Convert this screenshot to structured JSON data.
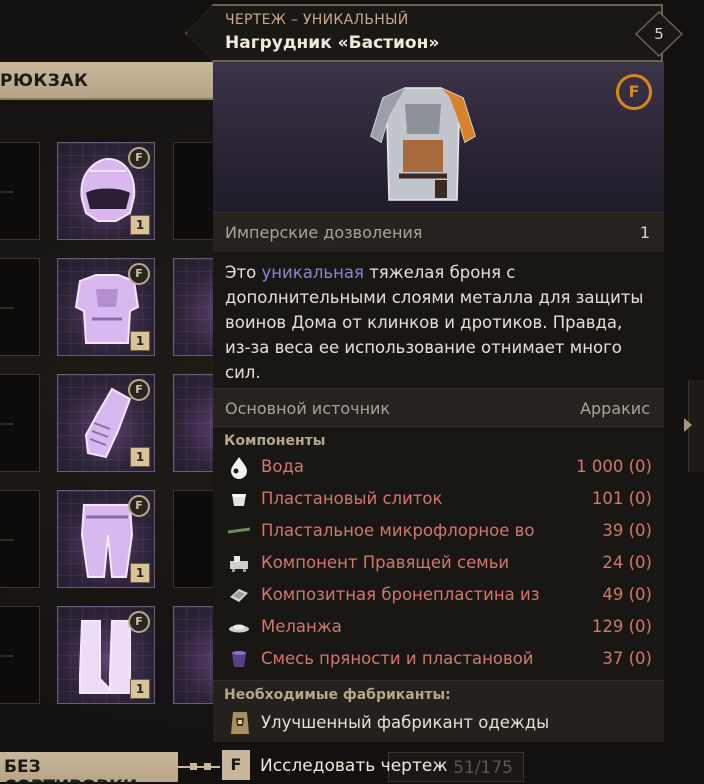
{
  "backpack": {
    "title": "РЮКЗАК",
    "items": [
      {
        "icon": "helmet-icon",
        "tier": "1"
      },
      {
        "icon": "chest-armor-icon",
        "tier": "1"
      },
      {
        "icon": "gauntlet-icon",
        "tier": "1"
      },
      {
        "icon": "leggings-icon",
        "tier": "1"
      },
      {
        "icon": "boots-icon",
        "tier": "1"
      }
    ],
    "sort_label": "БЕЗ СОРТИРОВКИ",
    "counter": "51/175"
  },
  "tooltip": {
    "category": "ЧЕРТЕЖ – УНИКАЛЬНЫЙ",
    "name": "Нагрудник «Бастион»",
    "level": "5",
    "permissions_label": "Имперские дозволения",
    "permissions_value": "1",
    "description": {
      "prefix": "Это",
      "highlight": "уникальная",
      "rest": "тяжелая броня с дополнительными слоями металла для защиты воинов Дома от клинков и дротиков. Правда, из-за веса ее использование отнимает много сил."
    },
    "source_label": "Основной источник",
    "source_value": "Арракис",
    "components_title": "Компоненты",
    "components": [
      {
        "name": "Вода",
        "amount": "1 000 (0)",
        "icon": "water-drop-icon"
      },
      {
        "name": "Пластановый слиток",
        "amount": "101 (0)",
        "icon": "plastanium-ingot-icon"
      },
      {
        "name": "Пластальное микрофлорное во",
        "amount": "39 (0)",
        "icon": "fiber-icon"
      },
      {
        "name": "Компонент Правящей семьи",
        "amount": "24 (0)",
        "icon": "great-house-component-icon"
      },
      {
        "name": "Композитная бронепластина из",
        "amount": "49 (0)",
        "icon": "armor-plate-icon"
      },
      {
        "name": "Меланжа",
        "amount": "129 (0)",
        "icon": "melange-icon"
      },
      {
        "name": "Смесь пряности и пластановой",
        "amount": "37 (0)",
        "icon": "spice-mix-icon"
      }
    ],
    "fabricators_title": "Необходимые фабриканты:",
    "fabricator": "Улучшенный фабрикант одежды",
    "action_key": "F",
    "action_label": "Исследовать чертеж"
  },
  "colors": {
    "accent_tan": "#c8b79a",
    "missing_red": "#d2776a",
    "unique_purple": "#8e86c8",
    "blueprint_orange": "#d6861f"
  }
}
